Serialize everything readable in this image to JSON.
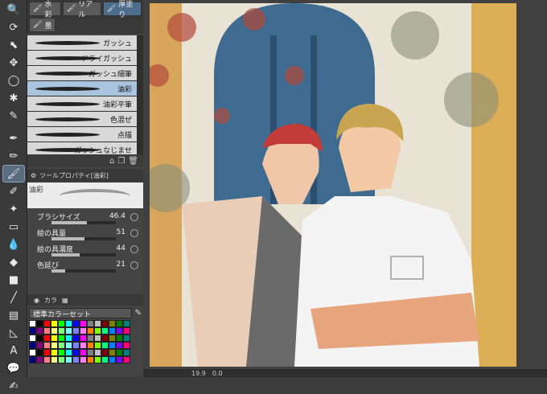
{
  "brush_tabs": [
    {
      "label": "水彩",
      "active": false
    },
    {
      "label": "リアル",
      "active": false
    },
    {
      "label": "厚塗り",
      "active": true
    }
  ],
  "brush_tabs2": [
    {
      "label": "墨"
    }
  ],
  "brushes": [
    {
      "label": "ガッシュ",
      "selected": false
    },
    {
      "label": "ドライガッシュ",
      "selected": false
    },
    {
      "label": "ガッシュ細筆",
      "selected": false
    },
    {
      "label": "油彩",
      "selected": true
    },
    {
      "label": "油彩平筆",
      "selected": false
    },
    {
      "label": "色混ぜ",
      "selected": false
    },
    {
      "label": "点描",
      "selected": false
    },
    {
      "label": "ガッシュなじませ",
      "selected": false
    }
  ],
  "tool_property": {
    "header": "ツールプロパティ[油彩]",
    "preview_name": "油彩",
    "props": [
      {
        "label": "ブラシサイズ",
        "value": "46.4",
        "fill": 0.55
      },
      {
        "label": "絵の具量",
        "value": "51",
        "fill": 0.51
      },
      {
        "label": "絵の具濃度",
        "value": "44",
        "fill": 0.44
      },
      {
        "label": "色延び",
        "value": "21",
        "fill": 0.21
      }
    ]
  },
  "color_panel": {
    "tab_label": "カラ",
    "set_name": "標準カラーセット"
  },
  "status": {
    "zoom": "19.9",
    "angle": "0.0"
  },
  "colors": {
    "accent": "#4d6d8c",
    "selected_row": "#a9c4dd"
  }
}
